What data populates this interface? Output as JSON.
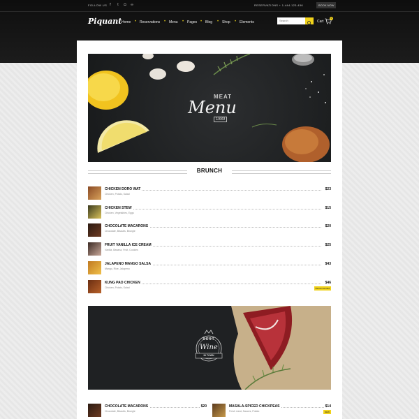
{
  "topbar": {
    "follow_label": "FOLLOW US",
    "social": [
      "facebook-icon",
      "twitter-icon",
      "instagram-icon",
      "tripadvisor-icon"
    ],
    "reservations": "RESERVATIONS + 1-444-123-456",
    "book_now": "BOOK NOW"
  },
  "nav": {
    "logo": "Piquant",
    "items": [
      "Home",
      "Reservations",
      "Menu",
      "Pages",
      "Blog",
      "Shop",
      "Elements"
    ],
    "search_placeholder": "Search",
    "cart_label": "Cart",
    "cart_count": "0"
  },
  "hero": {
    "kicker": "MEAT",
    "title": "Menu",
    "year": "1889"
  },
  "section": {
    "title": "BRUNCH"
  },
  "menu_items": [
    {
      "name": "CHICKEN DORO WAT",
      "desc": "Chicken, Potato, Salad",
      "price": "$23"
    },
    {
      "name": "CHICKEN STEW",
      "desc": "Chicken, Vegetables, Eggs",
      "price": "$15"
    },
    {
      "name": "CHOCOLATE MACARONS",
      "desc": "Chocolate, Biscuits, Brungle",
      "price": "$20"
    },
    {
      "name": "FRUIT VANILLA ICE CREAM",
      "desc": "Vanilla, Banana, Fruit, Cookies",
      "price": "$25"
    },
    {
      "name": "JALAPENO MANGO SALSA",
      "desc": "Mango, Rice, Jalapeno",
      "price": "$43"
    },
    {
      "name": "KUNG PAO CHICKEN",
      "desc": "Chicken, Potato, Salad",
      "price": "$46",
      "badge": "Recommended"
    }
  ],
  "wine": {
    "top": "BEST",
    "name": "Wine",
    "bottom": "IN TOWN"
  },
  "bottom_items": [
    {
      "name": "CHOCOLATE MACARONS",
      "desc": "Chocolate, Biscuits, Brungle",
      "price": "$20"
    },
    {
      "name": "MASALA-SPICED CHICKPEAS",
      "desc": "Fresh meat, Sauces, Potato",
      "price": "$14",
      "badge": "NEW"
    }
  ],
  "colors": {
    "accent": "#f0d21b",
    "dark": "#161616"
  }
}
